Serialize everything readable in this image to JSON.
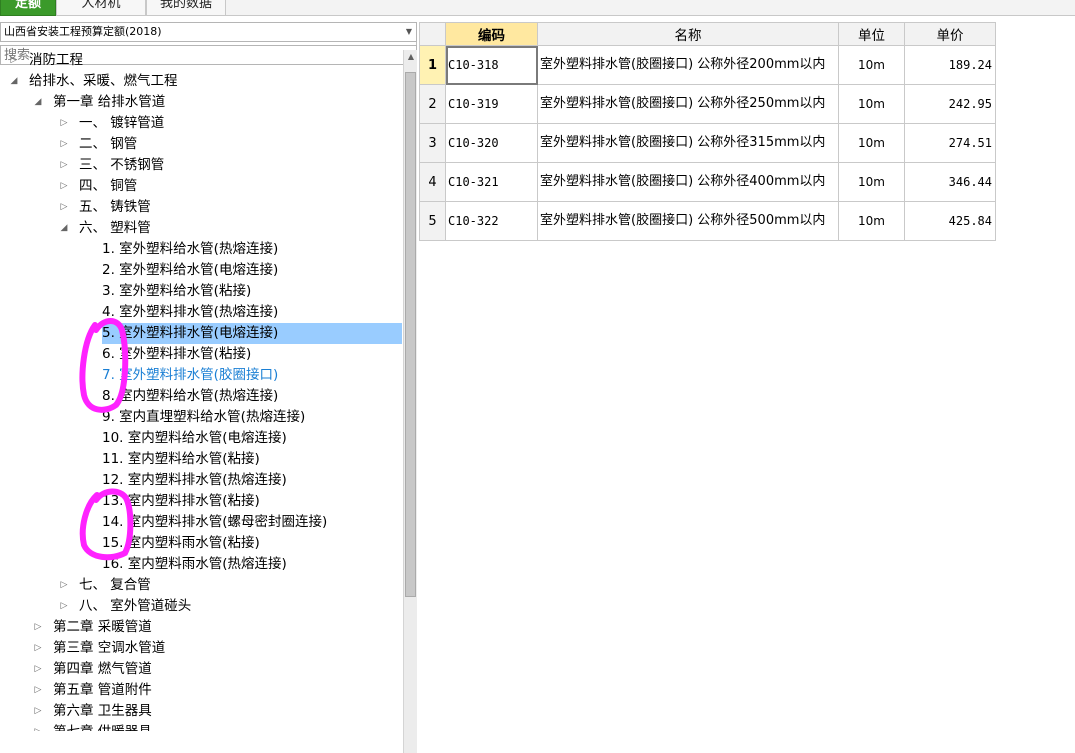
{
  "tabs": [
    {
      "label": "定额"
    },
    {
      "label": "人材机"
    },
    {
      "label": "我的数据"
    }
  ],
  "dropdown": {
    "value": "山西省安装工程预算定额(2018)"
  },
  "search": {
    "placeholder": "搜索"
  },
  "tree": [
    {
      "label": "消防工程",
      "toggle": "▷"
    },
    {
      "label": "给排水、采暖、燃气工程",
      "toggle": "◢"
    },
    {
      "label": "第一章 给排水管道",
      "toggle": "◢"
    },
    {
      "label": "一、 镀锌管道",
      "toggle": "▷"
    },
    {
      "label": "二、 钢管",
      "toggle": "▷"
    },
    {
      "label": "三、 不锈钢管",
      "toggle": "▷"
    },
    {
      "label": "四、 铜管",
      "toggle": "▷"
    },
    {
      "label": "五、 铸铁管",
      "toggle": "▷"
    },
    {
      "label": "六、 塑料管",
      "toggle": "◢"
    },
    {
      "label": "1. 室外塑料给水管(热熔连接)"
    },
    {
      "label": "2. 室外塑料给水管(电熔连接)"
    },
    {
      "label": "3. 室外塑料给水管(粘接)"
    },
    {
      "label": "4. 室外塑料排水管(热熔连接)"
    },
    {
      "label": "5. 室外塑料排水管(电熔连接)"
    },
    {
      "label": "6. 室外塑料排水管(粘接)"
    },
    {
      "label": "7. 室外塑料排水管(胶圈接口)"
    },
    {
      "label": "8. 室内塑料给水管(热熔连接)"
    },
    {
      "label": "9. 室内直埋塑料给水管(热熔连接)"
    },
    {
      "label": "10. 室内塑料给水管(电熔连接)"
    },
    {
      "label": "11. 室内塑料给水管(粘接)"
    },
    {
      "label": "12. 室内塑料排水管(热熔连接)"
    },
    {
      "label": "13. 室内塑料排水管(粘接)"
    },
    {
      "label": "14. 室内塑料排水管(螺母密封圈连接)"
    },
    {
      "label": "15. 室内塑料雨水管(粘接)"
    },
    {
      "label": "16. 室内塑料雨水管(热熔连接)"
    },
    {
      "label": "七、 复合管",
      "toggle": "▷"
    },
    {
      "label": "八、 室外管道碰头",
      "toggle": "▷"
    },
    {
      "label": "第二章 采暖管道",
      "toggle": "▷"
    },
    {
      "label": "第三章 空调水管道",
      "toggle": "▷"
    },
    {
      "label": "第四章 燃气管道",
      "toggle": "▷"
    },
    {
      "label": "第五章 管道附件",
      "toggle": "▷"
    },
    {
      "label": "第六章 卫生器具",
      "toggle": "▷"
    },
    {
      "label": "第七章 供暖器具",
      "toggle": "▷"
    }
  ],
  "grid": {
    "headers": {
      "code": "编码",
      "name": "名称",
      "unit": "单位",
      "price": "单价"
    },
    "rows": [
      {
        "idx": "1",
        "code": "C10-318",
        "name": "室外塑料排水管(胶圈接口) 公称外径200mm以内",
        "unit": "10m",
        "price": "189.24"
      },
      {
        "idx": "2",
        "code": "C10-319",
        "name": "室外塑料排水管(胶圈接口) 公称外径250mm以内",
        "unit": "10m",
        "price": "242.95"
      },
      {
        "idx": "3",
        "code": "C10-320",
        "name": "室外塑料排水管(胶圈接口) 公称外径315mm以内",
        "unit": "10m",
        "price": "274.51"
      },
      {
        "idx": "4",
        "code": "C10-321",
        "name": "室外塑料排水管(胶圈接口) 公称外径400mm以内",
        "unit": "10m",
        "price": "346.44"
      },
      {
        "idx": "5",
        "code": "C10-322",
        "name": "室外塑料排水管(胶圈接口) 公称外径500mm以内",
        "unit": "10m",
        "price": "425.84"
      }
    ]
  },
  "colors": {
    "accent_tab": "#3b9a2a",
    "selected_row": "#99ccff",
    "link_blue": "#1a7fd4",
    "annotation": "#ff22ff"
  }
}
